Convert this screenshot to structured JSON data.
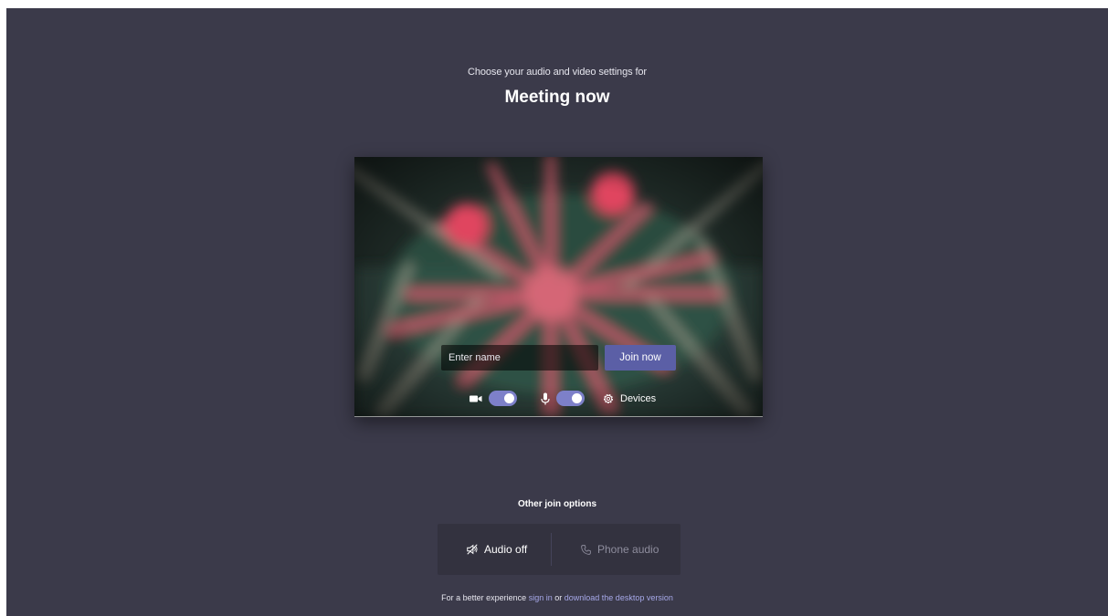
{
  "header": {
    "subtitle": "Choose your audio and video settings for",
    "meeting_title": "Meeting now"
  },
  "preview": {
    "name_placeholder": "Enter name",
    "join_label": "Join now",
    "controls": {
      "camera_icon": "video-camera-icon",
      "camera_on": true,
      "mic_icon": "microphone-icon",
      "mic_on": true,
      "devices_icon": "gear-icon",
      "devices_label": "Devices"
    }
  },
  "other_options": {
    "heading": "Other join options",
    "audio_off_icon": "speaker-off-icon",
    "audio_off_label": "Audio off",
    "phone_icon": "phone-icon",
    "phone_label": "Phone audio"
  },
  "footer": {
    "prefix": "For a better experience",
    "sign_in_label": "sign in",
    "or_text": "or",
    "download_label": "download the desktop version"
  },
  "colors": {
    "background": "#3b3a4a",
    "accent": "#5b5fa6",
    "toggle_on": "#7d80c9",
    "link": "#a6a8e8",
    "options_panel": "#33323f"
  }
}
